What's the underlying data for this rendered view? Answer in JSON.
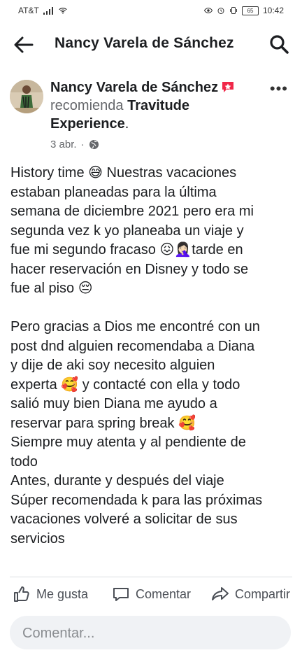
{
  "status_bar": {
    "carrier": "AT&T",
    "battery": "65",
    "time": "10:42"
  },
  "header": {
    "title": "Nancy Varela de Sánchez",
    "back_icon": "arrow-left-icon",
    "search_icon": "search-icon"
  },
  "post": {
    "author": "Nancy Varela de Sánchez",
    "recommends_word": "recomienda",
    "page_name": "Travitude Experience",
    "date": "3 abr.",
    "separator": "·",
    "audience_icon": "globe-icon",
    "more_label": "•••",
    "body_lines": [
      "History time 😅 Nuestras vacaciones",
      "estaban planeadas para la última",
      "semana de diciembre 2021 pero era mi",
      "segunda vez k yo planeaba un viaje y",
      "fue mi segundo fracaso 😖🤦🏻‍♀️tarde en",
      "hacer reservación en Disney y todo se",
      "fue al piso 😔",
      "",
      "Pero gracias a Dios me encontré con un",
      "post dnd alguien recomendaba a Diana",
      "y dije de aki soy necesito alguien",
      "experta 🥰  y contacté con ella y todo",
      "salió muy bien Diana me ayudo a",
      "reservar para spring break 🥰",
      "Siempre muy atenta y al pendiente  de",
      "todo",
      "Antes, durante  y después del viaje",
      "Súper recomendada k para las próximas",
      "vacaciones volveré a solicitar de sus",
      "servicios"
    ]
  },
  "actions": {
    "like": "Me gusta",
    "comment": "Comentar",
    "share": "Compartir"
  },
  "comment_input": {
    "placeholder": "Comentar..."
  },
  "colors": {
    "text": "#1c1e21",
    "secondary": "#65676b",
    "badge": "#f02849",
    "input_bg": "#f0f2f5"
  }
}
